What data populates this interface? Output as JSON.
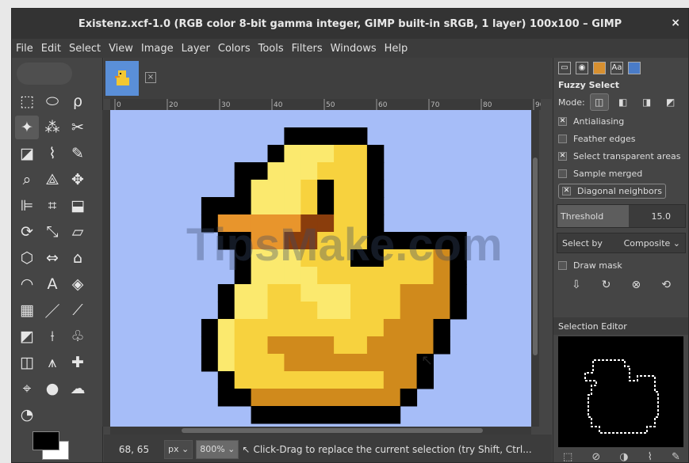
{
  "window": {
    "title": "Existenz.xcf-1.0 (RGB color 8-bit gamma integer, GIMP built-in sRGB, 1 layer) 100x100 – GIMP",
    "close": "×"
  },
  "menu": [
    "File",
    "Edit",
    "Select",
    "View",
    "Image",
    "Layer",
    "Colors",
    "Tools",
    "Filters",
    "Windows",
    "Help"
  ],
  "toolbox": {
    "tools": [
      {
        "name": "rect-select-icon",
        "glyph": "⬚"
      },
      {
        "name": "ellipse-select-icon",
        "glyph": "⬭"
      },
      {
        "name": "free-select-icon",
        "glyph": "ρ"
      },
      {
        "name": "fuzzy-select-icon",
        "glyph": "✦",
        "active": true
      },
      {
        "name": "select-by-color-icon",
        "glyph": "⁂"
      },
      {
        "name": "scissors-select-icon",
        "glyph": "✂"
      },
      {
        "name": "foreground-select-icon",
        "glyph": "◪"
      },
      {
        "name": "paths-icon",
        "glyph": "⌇"
      },
      {
        "name": "color-picker-icon",
        "glyph": "✎"
      },
      {
        "name": "zoom-icon",
        "glyph": "⌕"
      },
      {
        "name": "measure-icon",
        "glyph": "⟁"
      },
      {
        "name": "move-icon",
        "glyph": "✥"
      },
      {
        "name": "align-icon",
        "glyph": "⊫"
      },
      {
        "name": "crop-icon",
        "glyph": "⌗"
      },
      {
        "name": "unified-transform-icon",
        "glyph": "⬓"
      },
      {
        "name": "rotate-icon",
        "glyph": "⟳"
      },
      {
        "name": "scale-icon",
        "glyph": "⤡"
      },
      {
        "name": "shear-icon",
        "glyph": "▱"
      },
      {
        "name": "perspective-icon",
        "glyph": "⬡"
      },
      {
        "name": "flip-icon",
        "glyph": "⇔"
      },
      {
        "name": "cage-icon",
        "glyph": "⌂"
      },
      {
        "name": "warp-icon",
        "glyph": "◠"
      },
      {
        "name": "text-icon",
        "glyph": "A"
      },
      {
        "name": "bucket-fill-icon",
        "glyph": "◈"
      },
      {
        "name": "gradient-icon",
        "glyph": "▦"
      },
      {
        "name": "pencil-icon",
        "glyph": "／"
      },
      {
        "name": "paintbrush-icon",
        "glyph": "⟋"
      },
      {
        "name": "eraser-icon",
        "glyph": "◩"
      },
      {
        "name": "airbrush-icon",
        "glyph": "⟊"
      },
      {
        "name": "ink-icon",
        "glyph": "♧"
      },
      {
        "name": "mypaint-brush-icon",
        "glyph": "◫"
      },
      {
        "name": "clone-icon",
        "glyph": "⩚"
      },
      {
        "name": "heal-icon",
        "glyph": "✚"
      },
      {
        "name": "perspective-clone-icon",
        "glyph": "⌖"
      },
      {
        "name": "blur-icon",
        "glyph": "●"
      },
      {
        "name": "smudge-icon",
        "glyph": "☁"
      },
      {
        "name": "dodge-burn-icon",
        "glyph": "◔"
      }
    ]
  },
  "image_tab": {
    "thumb_icon": "duck-thumbnail-icon",
    "close": "×"
  },
  "ruler_ticks": [
    "0",
    "20",
    "30",
    "40",
    "50",
    "60",
    "70",
    "80",
    "90"
  ],
  "status": {
    "coords": "68, 65",
    "unit": "px",
    "zoom": "800%",
    "message": "Click-Drag to replace the current selection (try Shift, Ctrl..."
  },
  "dock": {
    "tool_options_title": "Fuzzy Select",
    "mode_label": "Mode:",
    "options": [
      {
        "label": "Antialiasing",
        "checked": true
      },
      {
        "label": "Feather edges",
        "checked": false
      },
      {
        "label": "Select transparent areas",
        "checked": true
      },
      {
        "label": "Sample merged",
        "checked": false
      },
      {
        "label": "Diagonal neighbors",
        "checked": true,
        "highlight": true
      }
    ],
    "threshold": {
      "label": "Threshold",
      "value": "15.0",
      "fraction": 0.06
    },
    "select_by": {
      "label": "Select by",
      "value": "Composite"
    },
    "draw_mask": {
      "label": "Draw mask",
      "checked": false
    },
    "selection_editor_title": "Selection Editor"
  },
  "watermark": "TipsMake.com"
}
